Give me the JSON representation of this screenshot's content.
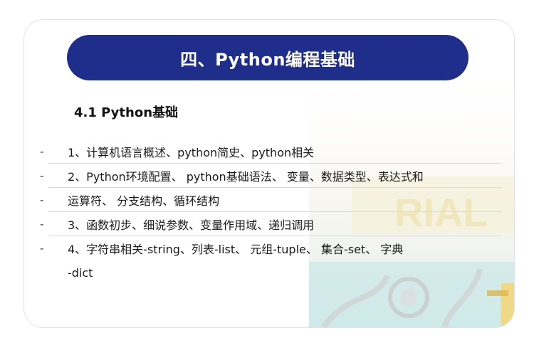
{
  "title": "四、Python编程基础",
  "section_heading": "4.1 Python基础",
  "items": [
    {
      "bullet": "-",
      "text": "1、计算机语言概述、python简史、python相关"
    },
    {
      "bullet": "-",
      "text": "2、Python环境配置、 python基础语法、 变量、数据类型、表达式和"
    },
    {
      "bullet": "-",
      "text": "运算符、 分支结构、循环结构"
    },
    {
      "bullet": "-",
      "text": "3、函数初步、细说参数、变量作用域、递归调用"
    },
    {
      "bullet": "-",
      "text": "4、字符串相关-string、列表-list、 元组-tuple、 集合-set、 字典"
    },
    {
      "bullet": "",
      "text": "-dict"
    }
  ],
  "colors": {
    "title_bar": "#1f2e8a",
    "title_text": "#ffffff",
    "card_border": "#e0e2ea"
  }
}
